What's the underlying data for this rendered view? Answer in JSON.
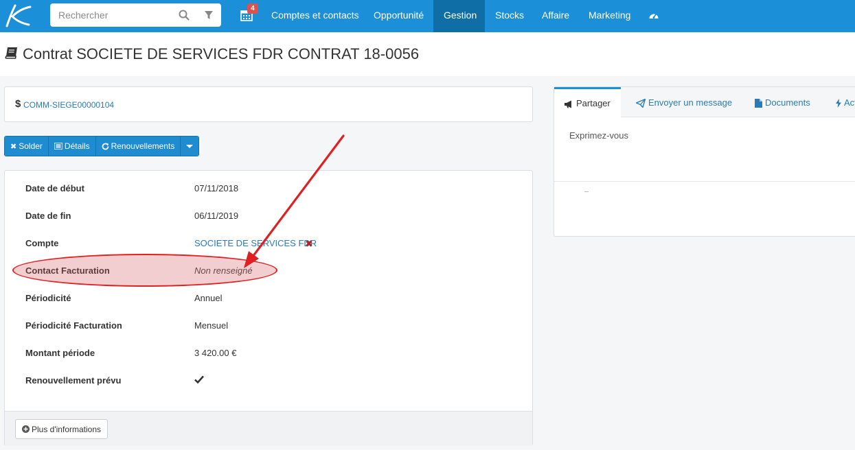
{
  "nav": {
    "search_placeholder": "Rechercher",
    "notification_count": "4",
    "items": [
      {
        "label": "Comptes et contacts"
      },
      {
        "label": "Opportunité"
      },
      {
        "label": "Gestion"
      },
      {
        "label": "Stocks"
      },
      {
        "label": "Affaire"
      },
      {
        "label": "Marketing"
      }
    ],
    "active_item": "Gestion"
  },
  "page": {
    "title": "Contrat SOCIETE DE SERVICES FDR CONTRAT 18-0056",
    "reference_link": "COMM-SIEGE00000104"
  },
  "actions": {
    "solder": "Solder",
    "details": "Détails",
    "renouvellements": "Renouvellements"
  },
  "fields": [
    {
      "label": "Date de début",
      "value": "07/11/2018"
    },
    {
      "label": "Date de fin",
      "value": "06/11/2019"
    },
    {
      "label": "Compte",
      "value": "SOCIETE DE SERVICES FDR"
    },
    {
      "label": "Contact Facturation",
      "value": "Non renseigné"
    },
    {
      "label": "Périodicité",
      "value": "Annuel"
    },
    {
      "label": "Périodicité Facturation",
      "value": "Mensuel"
    },
    {
      "label": "Montant période",
      "value": "3 420.00 €"
    },
    {
      "label": "Renouvellement prévu",
      "value": ""
    }
  ],
  "more_info_label": "Plus d'informations",
  "right_panel": {
    "tabs": [
      {
        "label": "Partager"
      },
      {
        "label": "Envoyer un message"
      },
      {
        "label": "Documents"
      },
      {
        "label": "Act"
      }
    ],
    "compose_placeholder": "Exprimez-vous"
  },
  "colors": {
    "nav_bg": "#1b8fd8",
    "nav_active": "#0f6ea6",
    "link": "#2a7ab8",
    "badge": "#d9534f",
    "annotation": "#e02020"
  }
}
